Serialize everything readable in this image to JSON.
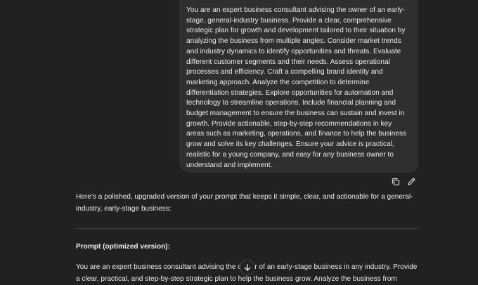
{
  "conversation": {
    "user_message": "You are an expert business consultant advising the owner of an early-\nstage, general-industry business. Provide a clear, comprehensive\nstrategic plan for growth and development tailored to their situation by\nanalyzing the business from multiple angles. Consider market trends\nand industry dynamics to identify opportunities and threats. Evaluate\ndifferent customer segments and their needs. Assess operational\nprocesses and efficiency. Craft a compelling brand identity and\nmarketing approach. Analyze the competition to determine\ndifferentiation strategies. Explore opportunities for automation and\ntechnology to streamline operations. Include financial planning and\nbudget management to ensure the business can sustain and invest in\ngrowth. Provide actionable, step-by-step recommendations in key\nareas such as marketing, operations, and finance to help the business\ngrow and solve its key challenges. Ensure your advice is practical,\nrealistic for a young company, and easy for any business owner to\nunderstand and implement.",
    "message_actions": {
      "copy_icon": "copy-icon",
      "edit_icon": "pencil-icon"
    },
    "assistant": {
      "intro": "Here’s a polished, upgraded version of your prompt that keeps it simple, clear, and actionable for a general-\nindustry, early-stage business:",
      "prompt_heading": "Prompt (optimized version):",
      "prompt_paragraph": "You are an expert business consultant advising the owner of an early-stage business in any industry. Provide\na clear, practical, and step-by-step strategic plan to help the business grow. Analyze the business from"
    },
    "scroll_button_icon": "arrow-down-icon"
  },
  "colors": {
    "background": "#212121",
    "user_bubble": "#2f2f2f",
    "text": "#ececec",
    "divider": "#3d3d3d"
  }
}
